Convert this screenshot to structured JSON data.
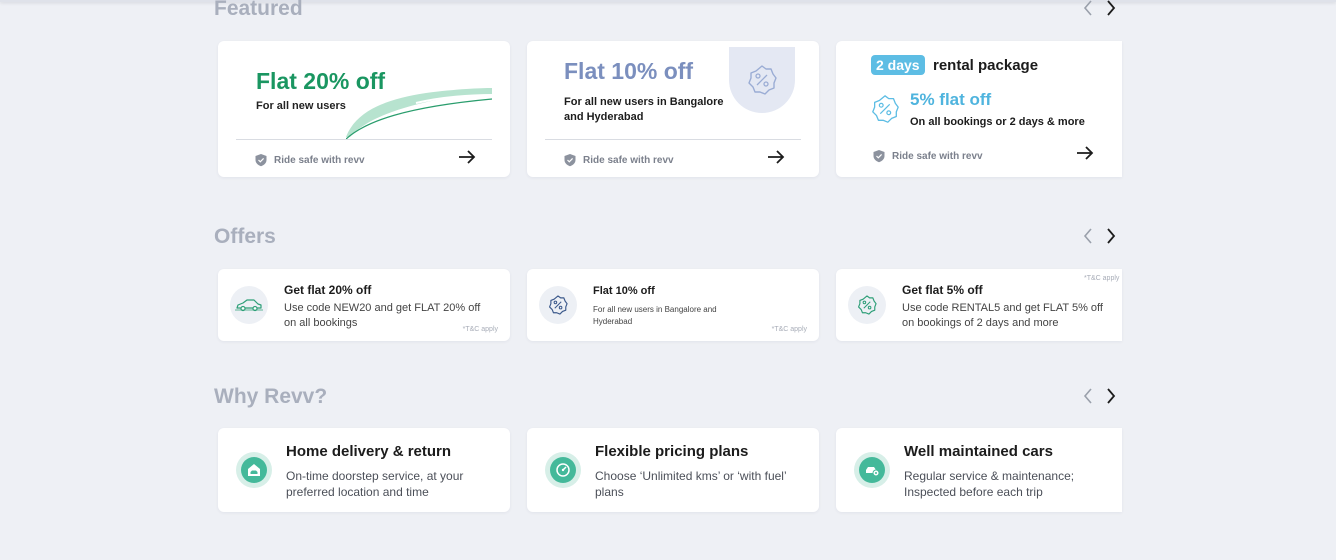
{
  "sections": {
    "featured": "Featured",
    "offers": "Offers",
    "why": "Why Revv?"
  },
  "featured": {
    "card1": {
      "title": "Flat 20% off",
      "subtitle": "For all new users",
      "footer": "Ride safe with revv"
    },
    "card2": {
      "title": "Flat 10% off",
      "subtitle": "For all new users in Bangalore and Hyderabad",
      "footer": "Ride safe with revv"
    },
    "card3": {
      "chip": "2 days",
      "heading": "rental package",
      "title": "5% flat off",
      "subtitle": "On all bookings or 2 days & more",
      "footer": "Ride safe with revv"
    }
  },
  "offers": [
    {
      "title": "Get flat 20% off",
      "desc": "Use code NEW20 and get FLAT 20% off on all bookings",
      "tnc": "*T&C apply"
    },
    {
      "title": "Flat 10% off",
      "desc": "For all new users in Bangalore and Hyderabad",
      "tnc": "*T&C apply"
    },
    {
      "title": "Get flat 5% off",
      "desc": "Use code RENTAL5 and get FLAT 5% off on bookings of 2 days and more",
      "tnc": "*T&C apply"
    }
  ],
  "why": [
    {
      "title": "Home delivery & return",
      "desc": "On-time doorstep service, at your preferred location and time"
    },
    {
      "title": "Flexible pricing plans",
      "desc": "Choose ‘Unlimited kms’ or ‘with fuel’ plans"
    },
    {
      "title": "Well maintained cars",
      "desc": "Regular service & maintenance; Inspected before each trip"
    }
  ],
  "icons": {
    "prev": "chevron-left-icon",
    "next": "chevron-right-icon",
    "shield": "shield-icon",
    "go": "arrow-right-icon",
    "discount": "discount-badge-icon",
    "car": "car-icon",
    "home": "home-car-icon",
    "meter": "speedometer-icon",
    "service": "car-service-icon"
  },
  "colors": {
    "green": "#1a9661",
    "blue_grey": "#7b8fbe",
    "sky": "#4fb4de",
    "teal": "#44b99a",
    "section_grey": "#a9afbd"
  }
}
